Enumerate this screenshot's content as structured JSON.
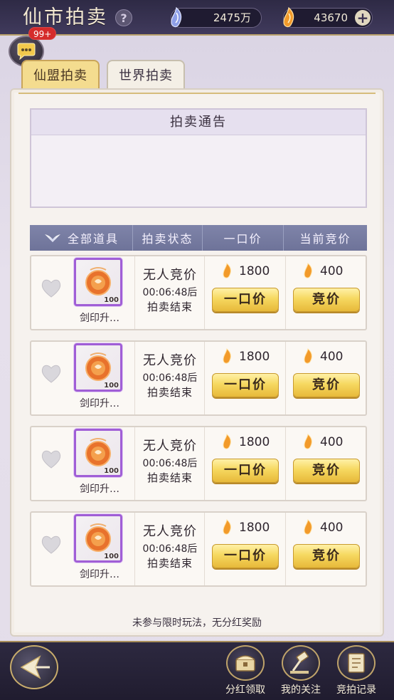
{
  "header": {
    "title": "仙市拍卖",
    "help_label": "?",
    "jade_amount": "2475万",
    "gold_amount": "43670",
    "plus_label": "+"
  },
  "chat": {
    "badge": "99+"
  },
  "tabs": [
    {
      "label": "仙盟拍卖",
      "active": true
    },
    {
      "label": "世界拍卖",
      "active": false
    }
  ],
  "notice": {
    "title": "拍卖通告"
  },
  "table": {
    "headers": [
      "全部道具",
      "拍卖状态",
      "一口价",
      "当前竞价"
    ],
    "rows": [
      {
        "item_name": "剑印升…",
        "level": "100",
        "status": "无人竞价",
        "time": "00:06:48后",
        "end": "拍卖结束",
        "buyout_price": "1800",
        "bid_price": "400",
        "buyout_label": "一口价",
        "bid_label": "竞价"
      },
      {
        "item_name": "剑印升…",
        "level": "100",
        "status": "无人竞价",
        "time": "00:06:48后",
        "end": "拍卖结束",
        "buyout_price": "1800",
        "bid_price": "400",
        "buyout_label": "一口价",
        "bid_label": "竞价"
      },
      {
        "item_name": "剑印升…",
        "level": "100",
        "status": "无人竞价",
        "time": "00:06:48后",
        "end": "拍卖结束",
        "buyout_price": "1800",
        "bid_price": "400",
        "buyout_label": "一口价",
        "bid_label": "竞价"
      },
      {
        "item_name": "剑印升…",
        "level": "100",
        "status": "无人竞价",
        "time": "00:06:48后",
        "end": "拍卖结束",
        "buyout_price": "1800",
        "bid_price": "400",
        "buyout_label": "一口价",
        "bid_label": "竞价"
      }
    ]
  },
  "footer_note": "未参与限时玩法，无分红奖励",
  "bottom_nav": [
    {
      "label": "分红领取",
      "icon": "treasure-chest-icon"
    },
    {
      "label": "我的关注",
      "icon": "auction-hammer-icon"
    },
    {
      "label": "竞拍记录",
      "icon": "record-book-icon"
    }
  ],
  "colors": {
    "gold_button": "#f6d860",
    "item_frame_purple": "#a05ed6",
    "header_bar": "#2e2a45",
    "table_header": "#7f84a9"
  }
}
